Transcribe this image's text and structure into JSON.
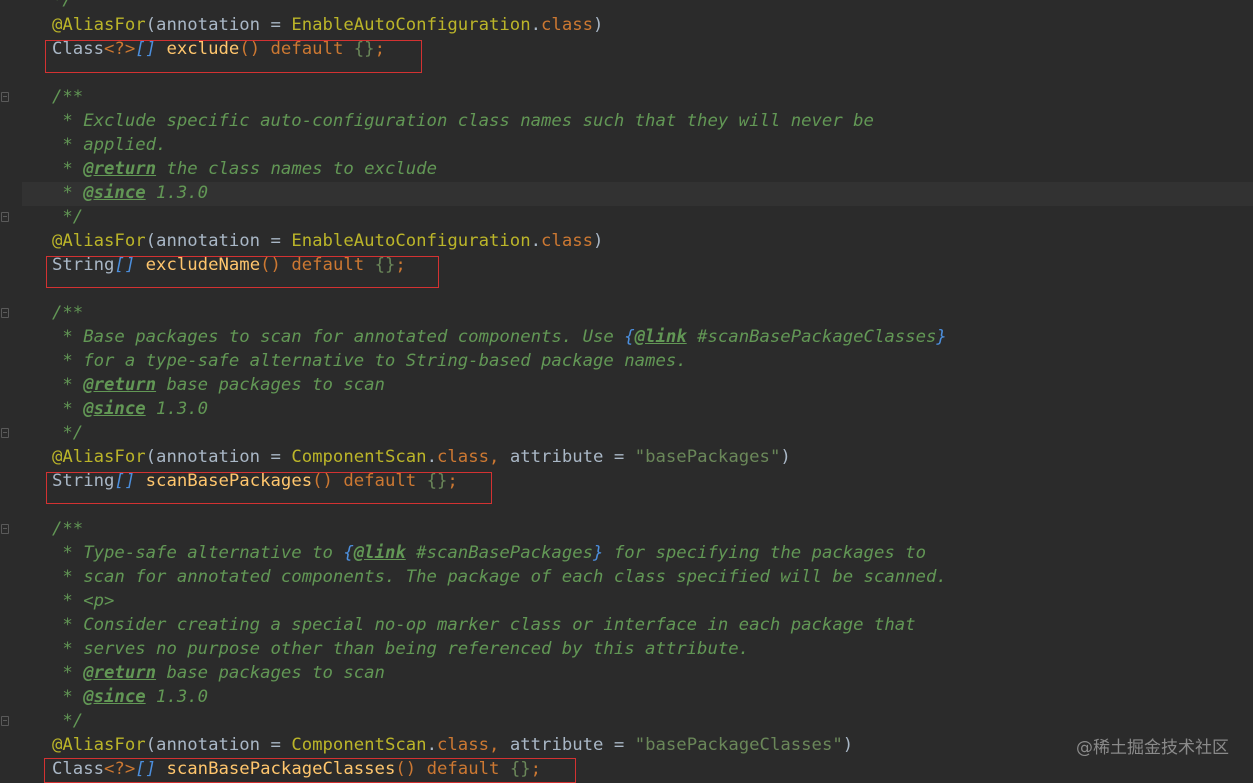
{
  "colors": {
    "background": "#2b2b2b",
    "annotation": "#bbb529",
    "keyword": "#cc7832",
    "string": "#6a8759",
    "method": "#ffc66d",
    "doc_comment": "#629755",
    "doc_link": "#4c8fdd",
    "highlight_border": "#d33232"
  },
  "lines": {
    "l0": {
      "doc_end": "*/"
    },
    "l1": {
      "annotation": "@AliasFor",
      "open": "(annotation = ",
      "type": "EnableAutoConfiguration",
      "dot": ".",
      "class_kw": "class",
      "close": ")"
    },
    "l2": {
      "type": "Class",
      "generic": "<?>",
      "array": "[]",
      "name": "exclude",
      "parens": "()",
      "default_kw": "default",
      "value": "{}",
      "semi": ";"
    },
    "l3": {
      "doc_start": "/**"
    },
    "l4": {
      "text": " * Exclude specific auto-configuration class names such that they will never be"
    },
    "l5": {
      "text": " * applied."
    },
    "l6": {
      "prefix": " * ",
      "tag": "@return",
      "text": " the class names to exclude"
    },
    "l7": {
      "prefix": " * ",
      "tag": "@since",
      "text": " 1.3.0"
    },
    "l8": {
      "doc_end": " */"
    },
    "l9": {
      "annotation": "@AliasFor",
      "open": "(annotation = ",
      "type": "EnableAutoConfiguration",
      "dot": ".",
      "class_kw": "class",
      "close": ")"
    },
    "l10": {
      "type": "String",
      "array": "[]",
      "name": "excludeName",
      "parens": "()",
      "default_kw": "default",
      "value": "{}",
      "semi": ";"
    },
    "l11": {
      "doc_start": "/**"
    },
    "l12": {
      "text_before": " * Base packages to scan for annotated components. Use ",
      "brace_open": "{",
      "tag": "@link",
      "link_text": " #scanBasePackageClasses",
      "brace_close": "}"
    },
    "l13": {
      "text": " * for a type-safe alternative to String-based package names."
    },
    "l14": {
      "prefix": " * ",
      "tag": "@return",
      "text": " base packages to scan"
    },
    "l15": {
      "prefix": " * ",
      "tag": "@since",
      "text": " 1.3.0"
    },
    "l16": {
      "doc_end": " */"
    },
    "l17": {
      "annotation": "@AliasFor",
      "open": "(annotation = ",
      "type": "ComponentScan",
      "dot": ".",
      "class_kw": "class",
      "comma": ", ",
      "attr": "attribute = ",
      "string": "\"basePackages\"",
      "close": ")"
    },
    "l18": {
      "type": "String",
      "array": "[]",
      "name": "scanBasePackages",
      "parens": "()",
      "default_kw": "default",
      "value": "{}",
      "semi": ";"
    },
    "l19": {
      "doc_start": "/**"
    },
    "l20": {
      "text_before": " * Type-safe alternative to ",
      "brace_open": "{",
      "tag": "@link",
      "link_text": " #scanBasePackages",
      "brace_close": "}",
      "text_after": " for specifying the packages to"
    },
    "l21": {
      "text": " * scan for annotated components. The package of each class specified will be scanned."
    },
    "l22": {
      "text": " * <p>"
    },
    "l23": {
      "text": " * Consider creating a special no-op marker class or interface in each package that"
    },
    "l24": {
      "text": " * serves no purpose other than being referenced by this attribute."
    },
    "l25": {
      "prefix": " * ",
      "tag": "@return",
      "text": " base packages to scan"
    },
    "l26": {
      "prefix": " * ",
      "tag": "@since",
      "text": " 1.3.0"
    },
    "l27": {
      "doc_end": " */"
    },
    "l28": {
      "annotation": "@AliasFor",
      "open": "(annotation = ",
      "type": "ComponentScan",
      "dot": ".",
      "class_kw": "class",
      "comma": ", ",
      "attr": "attribute = ",
      "string": "\"basePackageClasses\"",
      "close": ")"
    },
    "l29": {
      "type": "Class",
      "generic": "<?>",
      "array": "[]",
      "name": "scanBasePackageClasses",
      "parens": "()",
      "default_kw": "default",
      "value": "{}",
      "semi": ";"
    }
  },
  "watermark": "@稀土掘金技术社区"
}
